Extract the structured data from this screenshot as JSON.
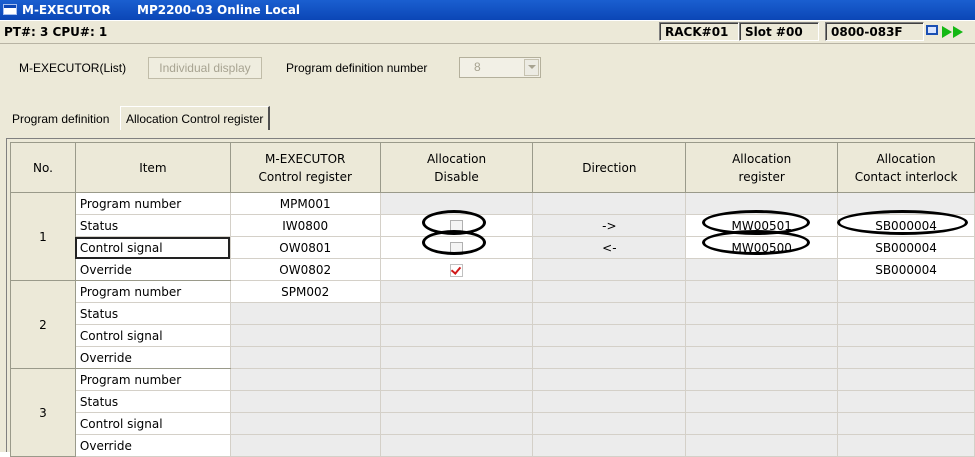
{
  "window": {
    "app_name": "M-EXECUTOR",
    "subtitle": "MP2200-03 Online Local"
  },
  "status_bar": {
    "pt_cpu": "PT#: 3 CPU#: 1",
    "rack": "RACK#01",
    "slot": "Slot #00",
    "range": "0800-083F",
    "online_icon": "online-status-icon"
  },
  "toolbar": {
    "list_label": "M-EXECUTOR(List)",
    "individual_display": "Individual display",
    "program_def_label": "Program definition number",
    "program_def_value": "8"
  },
  "tabs": [
    {
      "label": "Program definition",
      "active": false
    },
    {
      "label": "Allocation Control register",
      "active": true
    }
  ],
  "table": {
    "headers": {
      "no": "No.",
      "item": "Item",
      "ctrl_line1": "M-EXECUTOR",
      "ctrl_line2": "Control register",
      "disable_line1": "Allocation",
      "disable_line2": "Disable",
      "direction": "Direction",
      "reg_line1": "Allocation",
      "reg_line2": "register",
      "contact_line1": "Allocation",
      "contact_line2": "Contact interlock"
    },
    "groups": [
      {
        "no": "1",
        "rows": [
          {
            "item": "Program number",
            "ctrl": "MPM001",
            "disable": null,
            "direction": "",
            "register": "",
            "contact": ""
          },
          {
            "item": "Status",
            "ctrl": "IW0800",
            "disable": false,
            "direction": "->",
            "register": "MW00501",
            "contact": "SB000004"
          },
          {
            "item": "Control signal",
            "ctrl": "OW0801",
            "disable": false,
            "direction": "<-",
            "register": "MW00500",
            "contact": "SB000004"
          },
          {
            "item": "Override",
            "ctrl": "OW0802",
            "disable": true,
            "direction": "",
            "register": "",
            "contact": "SB000004"
          }
        ]
      },
      {
        "no": "2",
        "rows": [
          {
            "item": "Program number",
            "ctrl": "SPM002"
          },
          {
            "item": "Status",
            "ctrl": ""
          },
          {
            "item": "Control signal",
            "ctrl": ""
          },
          {
            "item": "Override",
            "ctrl": ""
          }
        ]
      },
      {
        "no": "3",
        "rows": [
          {
            "item": "Program number",
            "ctrl": ""
          },
          {
            "item": "Status",
            "ctrl": ""
          },
          {
            "item": "Control signal",
            "ctrl": ""
          },
          {
            "item": "Override",
            "ctrl": ""
          }
        ]
      }
    ]
  }
}
